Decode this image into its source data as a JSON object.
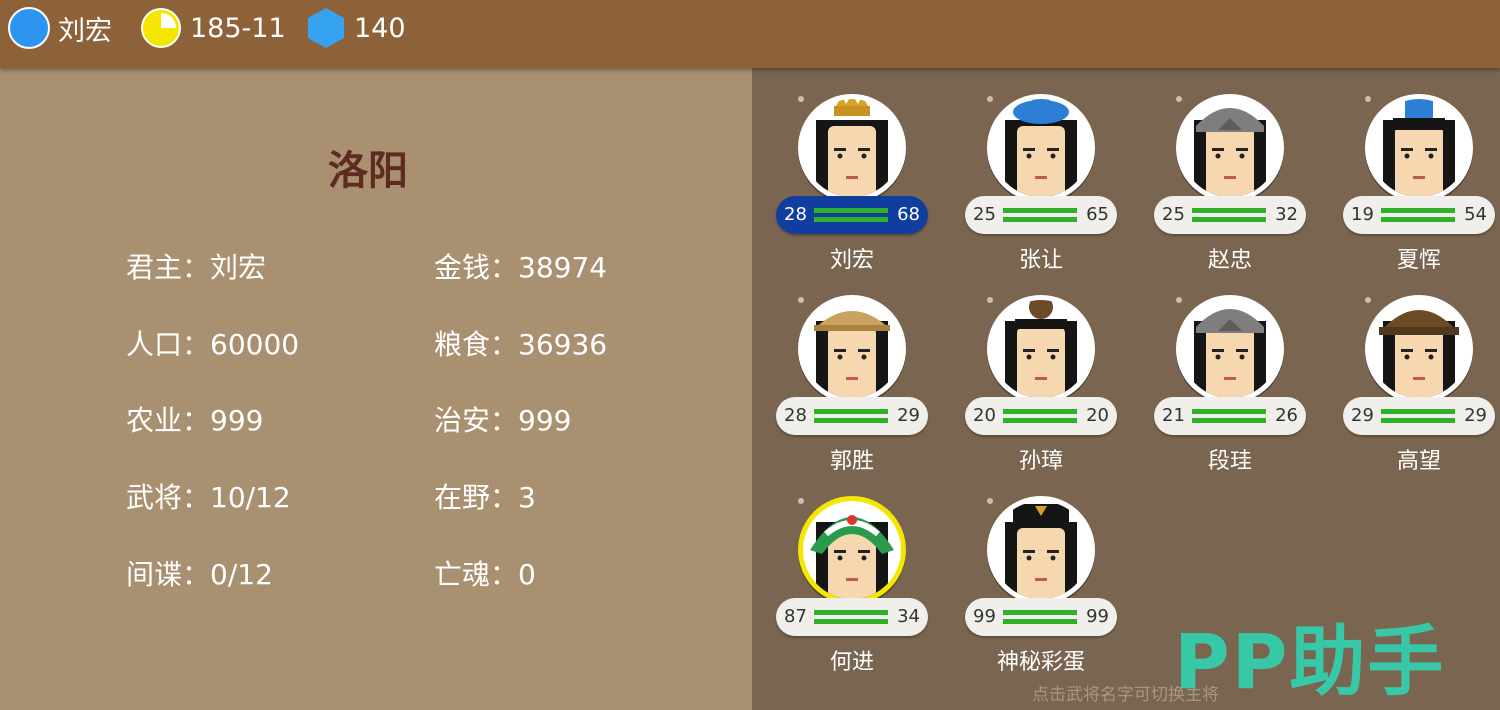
{
  "topbar": {
    "ruler_name": "刘宏",
    "date": "185-11",
    "gems": "140"
  },
  "city": {
    "name": "洛阳",
    "stats": [
      {
        "label": "君主：",
        "value": "刘宏"
      },
      {
        "label": "金钱：",
        "value": "38974"
      },
      {
        "label": "人口：",
        "value": "60000"
      },
      {
        "label": "粮食：",
        "value": "36936"
      },
      {
        "label": "农业：",
        "value": "999"
      },
      {
        "label": "治安：",
        "value": "999"
      },
      {
        "label": "武将：",
        "value": "10/12"
      },
      {
        "label": "在野：",
        "value": "3"
      },
      {
        "label": "间谍：",
        "value": "0/12"
      },
      {
        "label": "亡魂：",
        "value": "0"
      }
    ]
  },
  "generals": [
    {
      "name": "刘宏",
      "left": "28",
      "right": "68",
      "selected": true,
      "headgear": "crown"
    },
    {
      "name": "张让",
      "left": "25",
      "right": "65",
      "selected": false,
      "headgear": "blue-cap"
    },
    {
      "name": "赵忠",
      "left": "25",
      "right": "32",
      "selected": false,
      "headgear": "gray-helmet"
    },
    {
      "name": "夏恽",
      "left": "19",
      "right": "54",
      "selected": false,
      "headgear": "blue-square"
    },
    {
      "name": "郭胜",
      "left": "28",
      "right": "29",
      "selected": false,
      "headgear": "straw-hat"
    },
    {
      "name": "孙璋",
      "left": "20",
      "right": "20",
      "selected": false,
      "headgear": "bun"
    },
    {
      "name": "段珪",
      "left": "21",
      "right": "26",
      "selected": false,
      "headgear": "gray-helmet"
    },
    {
      "name": "高望",
      "left": "29",
      "right": "29",
      "selected": false,
      "headgear": "brown-hat"
    },
    {
      "name": "何进",
      "left": "87",
      "right": "34",
      "selected": false,
      "headgear": "green-helmet"
    },
    {
      "name": "神秘彩蛋",
      "left": "99",
      "right": "99",
      "selected": false,
      "headgear": "official-hat"
    }
  ],
  "hint": "点击武将名字可切换主将",
  "watermark": "PP助手",
  "colors": {
    "topbar": "#8d6238",
    "left_panel": "#a89070",
    "right_panel": "#7a6650",
    "selected_bar": "#0f3e9e",
    "stat_bar": "#2fb12a",
    "city_name": "#5e2a22"
  }
}
